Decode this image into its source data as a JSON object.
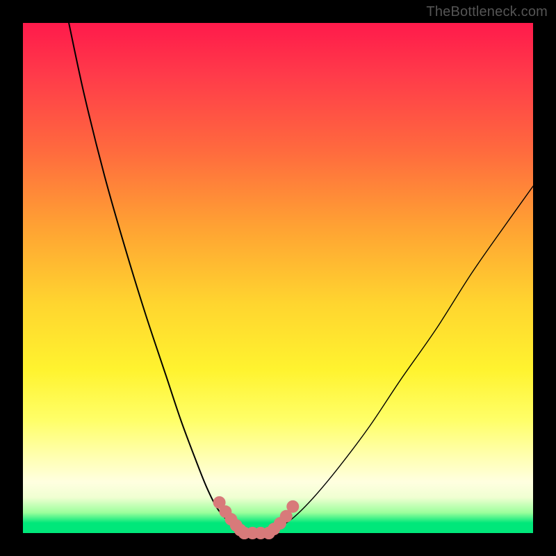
{
  "watermark": "TheBottleneck.com",
  "chart_data": {
    "type": "line",
    "title": "",
    "xlabel": "",
    "ylabel": "",
    "xlim": [
      0,
      100
    ],
    "ylim": [
      0,
      100
    ],
    "series": [
      {
        "name": "left-curve",
        "x": [
          9,
          12,
          16,
          20,
          24,
          28,
          31,
          34,
          36,
          38,
          40,
          41,
          42,
          43
        ],
        "y": [
          100,
          86,
          70,
          56,
          43,
          31,
          22,
          14,
          9,
          5,
          2.5,
          1.2,
          0.5,
          0
        ],
        "color": "#000000"
      },
      {
        "name": "right-curve",
        "x": [
          48,
          50,
          53,
          57,
          62,
          68,
          74,
          81,
          88,
          95,
          100
        ],
        "y": [
          0,
          1,
          3,
          7,
          13,
          21,
          30,
          40,
          51,
          61,
          68
        ],
        "color": "#000000"
      },
      {
        "name": "bottom-flat",
        "x": [
          43,
          48
        ],
        "y": [
          0,
          0
        ],
        "color": "#000000"
      }
    ],
    "markers": [
      {
        "name": "left-dots",
        "color": "#d87a7a",
        "radius": 9,
        "x": [
          38.5,
          39.7,
          40.8,
          41.8,
          42.6,
          43.4
        ],
        "y": [
          6.0,
          4.2,
          2.7,
          1.5,
          0.6,
          0.0
        ]
      },
      {
        "name": "bottom-dots",
        "color": "#d87a7a",
        "radius": 9,
        "x": [
          43.4,
          45.0,
          46.6,
          48.2
        ],
        "y": [
          0,
          0,
          0,
          0
        ]
      },
      {
        "name": "right-dots",
        "color": "#d87a7a",
        "radius": 9,
        "x": [
          48.2,
          49.2,
          50.4,
          51.6,
          52.9
        ],
        "y": [
          0.0,
          0.8,
          1.9,
          3.3,
          5.2
        ]
      }
    ],
    "gradient_stops": [
      {
        "pos": 0,
        "color": "#ff1a4b"
      },
      {
        "pos": 55,
        "color": "#ffd52f"
      },
      {
        "pos": 90,
        "color": "#ffffe0"
      },
      {
        "pos": 100,
        "color": "#00e77a"
      }
    ]
  }
}
